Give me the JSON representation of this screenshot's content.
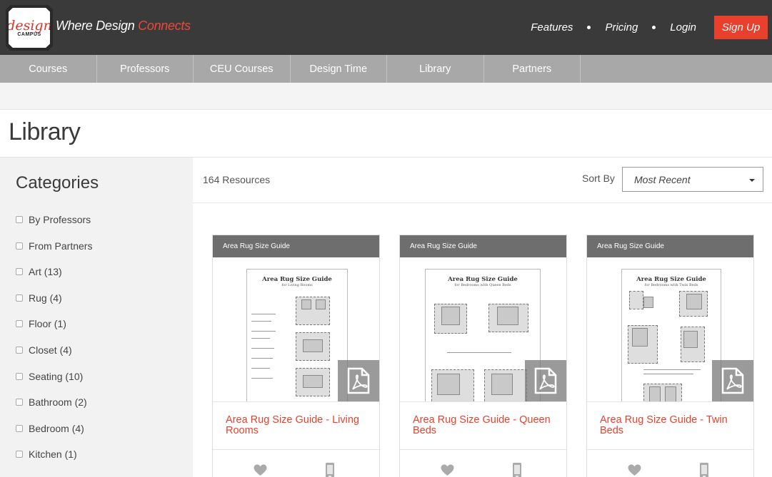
{
  "header": {
    "logo": {
      "script": "design",
      "small": "CAMPUS"
    },
    "tagline_main": "Where Design ",
    "tagline_accent": "Connects",
    "nav": [
      "Features",
      "Pricing",
      "Login"
    ],
    "signup_label": "Sign Up",
    "colors": {
      "bar": "#3a3a3a",
      "accent": "#e8402d"
    }
  },
  "subnav": [
    "Courses",
    "Professors",
    "CEU Courses",
    "Design Time",
    "Library",
    "Partners"
  ],
  "page": {
    "title": "Library"
  },
  "sidebar": {
    "heading": "Categories",
    "categories": [
      "By Professors",
      "From Partners",
      "Art (13)",
      "Rug (4)",
      "Floor (1)",
      "Closet (4)",
      "Seating (10)",
      "Bathroom (2)",
      "Bedroom (4)",
      "Kitchen (1)"
    ]
  },
  "toolbar": {
    "resource_count": "164 Resources",
    "sort_label": "Sort By",
    "sort_value": "Most Recent"
  },
  "cards": [
    {
      "header": "Area Rug Size Guide",
      "title": "Area Rug Size Guide - Living Rooms",
      "thumb_title": "Area Rug Size Guide",
      "thumb_sub": "for Living Rooms",
      "icon": "pdf-icon"
    },
    {
      "header": "Area Rug Size Guide",
      "title": "Area Rug Size Guide - Queen Beds",
      "thumb_title": "Area Rug Size Guide",
      "thumb_sub": "for Bedrooms with Queen Beds",
      "icon": "pdf-icon"
    },
    {
      "header": "Area Rug Size Guide",
      "title": "Area Rug Size Guide - Twin Beds",
      "thumb_title": "Area Rug Size Guide",
      "thumb_sub": "for Bedrooms with Twin Beds",
      "icon": "pdf-icon"
    }
  ]
}
